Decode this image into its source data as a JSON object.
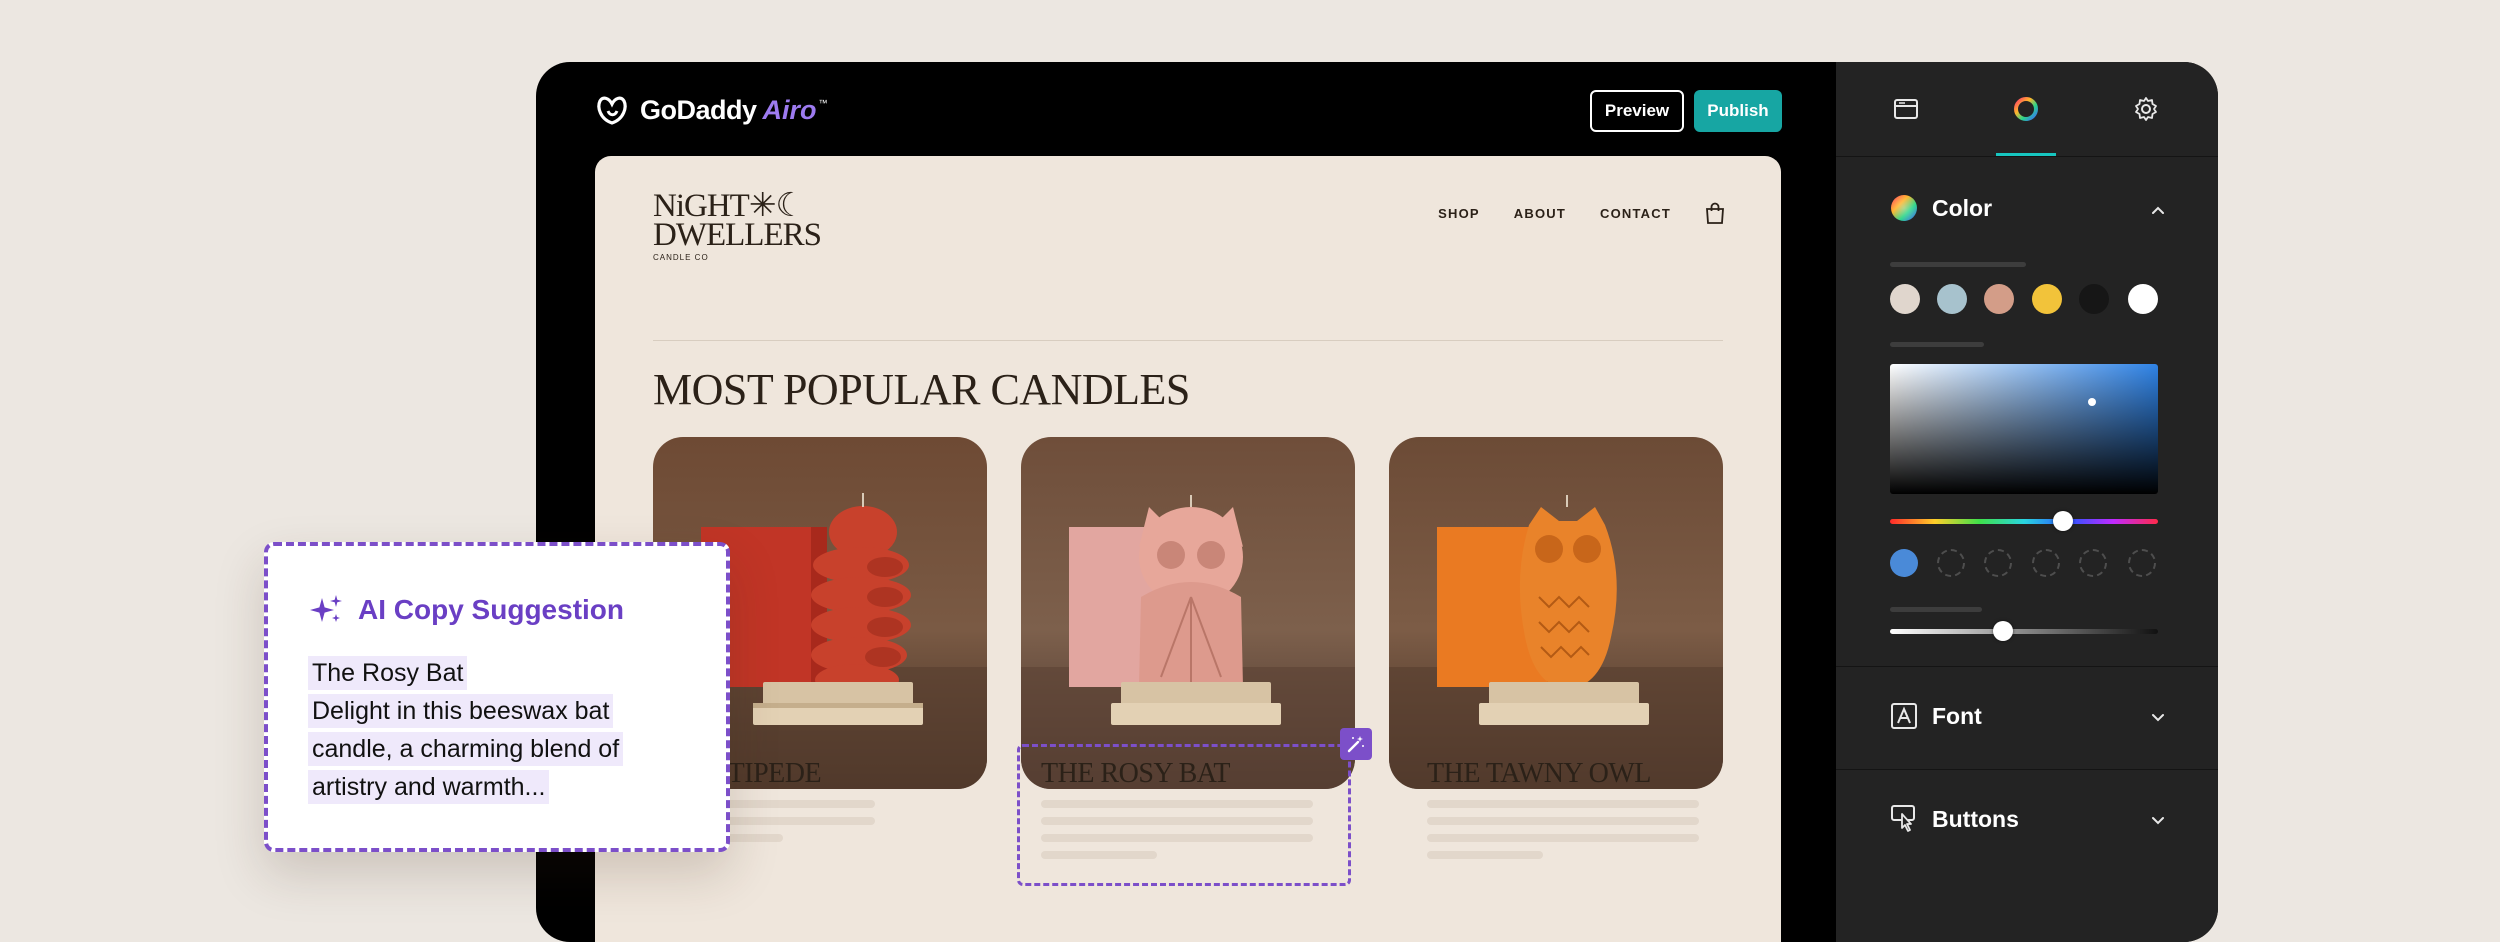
{
  "app": {
    "brand": "GoDaddy",
    "brand_accent": "Airo",
    "brand_tm": "™",
    "preview_label": "Preview",
    "publish_label": "Publish",
    "accent_color": "#17a6a3",
    "ai_color": "#7c4fc9"
  },
  "site": {
    "logo_line1": "NiGHT✳☾",
    "logo_line2": "DWELLERS",
    "logo_sub": "CANDLE CO",
    "nav": [
      "SHOP",
      "ABOUT",
      "CONTACT"
    ],
    "cart_icon": "shopping-bag-icon",
    "section_title": "MOST POPULAR CANDLES",
    "products": [
      {
        "name": "E SCENTIPEDE",
        "candle_color": "#c8412c",
        "box_color": "#d23a2a"
      },
      {
        "name": "THE ROSY BAT",
        "candle_color": "#e7a79a",
        "box_color": "#e2a6a0"
      },
      {
        "name": "THE TAWNY OWL",
        "candle_color": "#e9832a",
        "box_color": "#ea7a22"
      }
    ]
  },
  "panel": {
    "tabs": [
      "layout-icon",
      "color-wheel-icon",
      "settings-gear-icon"
    ],
    "active_tab": 1,
    "color": {
      "title": "Color",
      "swatches": [
        "#e0d6cd",
        "#a7c2cd",
        "#d39d88",
        "#f2c33a",
        "#161616",
        "#ffffff"
      ],
      "picker_base": "#2f83e6",
      "hue_position": 0.65,
      "alpha_position": 0.42,
      "selected_slot_color": "#4a8ad8"
    },
    "font_title": "Font",
    "buttons_title": "Buttons"
  },
  "ai_suggestion": {
    "title": "AI Copy Suggestion",
    "lines": [
      "The Rosy Bat",
      "Delight in this beeswax bat",
      "candle, a charming blend of",
      "artistry and warmth..."
    ]
  }
}
